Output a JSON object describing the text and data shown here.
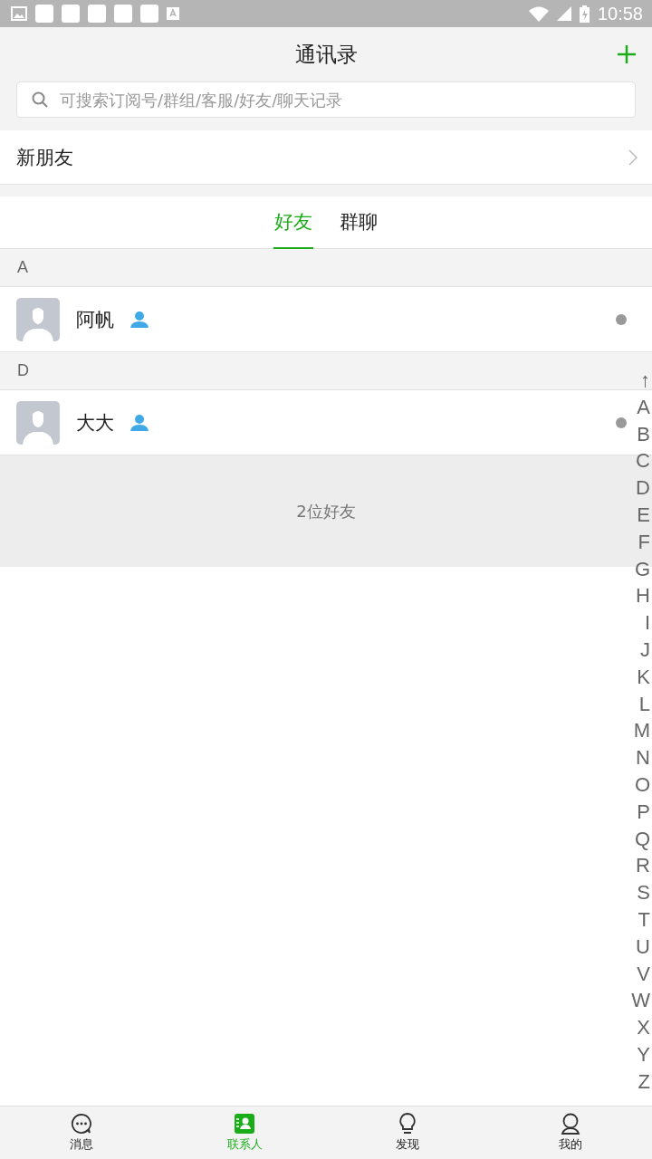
{
  "status_bar": {
    "time": "10:58"
  },
  "header": {
    "title": "通讯录"
  },
  "search": {
    "placeholder": "可搜索订阅号/群组/客服/好友/聊天记录"
  },
  "new_friends": {
    "label": "新朋友"
  },
  "tabs": [
    {
      "label": "好友",
      "selected": true
    },
    {
      "label": "群聊",
      "selected": false
    }
  ],
  "sections": [
    {
      "letter": "A",
      "contacts": [
        {
          "name": "阿帆"
        }
      ]
    },
    {
      "letter": "D",
      "contacts": [
        {
          "name": "大大"
        }
      ]
    }
  ],
  "friend_count": "2位好友",
  "index": [
    "↑",
    "A",
    "B",
    "C",
    "D",
    "E",
    "F",
    "G",
    "H",
    "I",
    "J",
    "K",
    "L",
    "M",
    "N",
    "O",
    "P",
    "Q",
    "R",
    "S",
    "T",
    "U",
    "V",
    "W",
    "X",
    "Y",
    "Z"
  ],
  "bottom_nav": [
    {
      "kind": "chat",
      "label": "消息",
      "selected": false
    },
    {
      "kind": "contacts",
      "label": "联系人",
      "selected": true
    },
    {
      "kind": "discover",
      "label": "发现",
      "selected": false
    },
    {
      "kind": "me",
      "label": "我的",
      "selected": false
    }
  ]
}
